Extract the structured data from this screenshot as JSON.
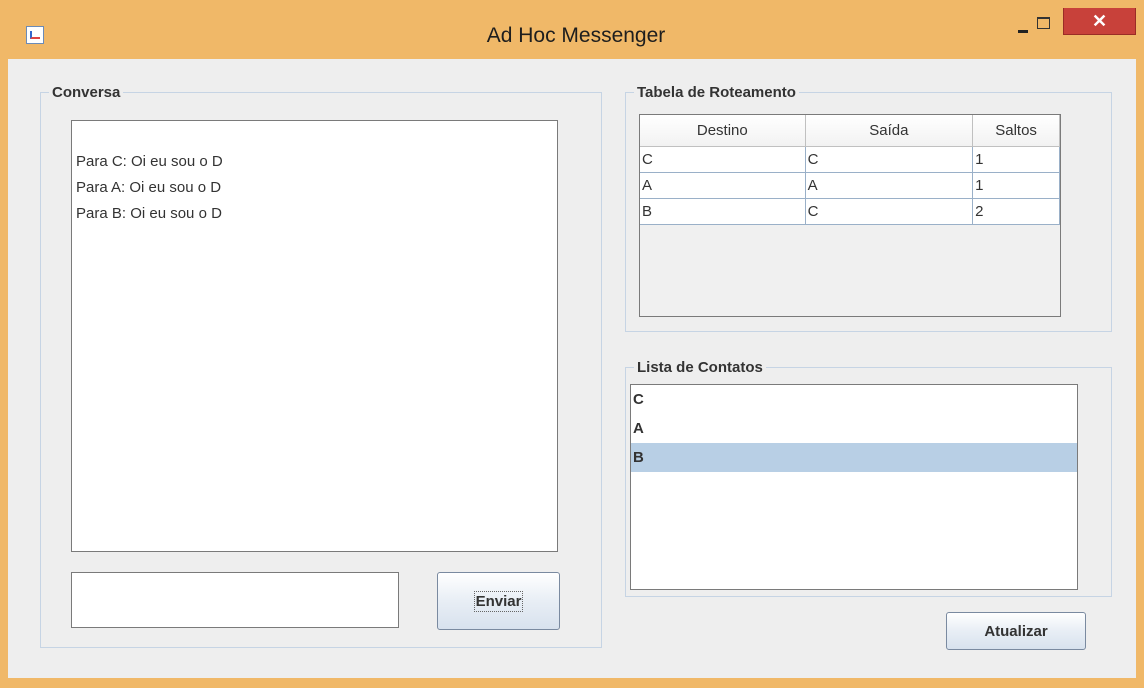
{
  "window": {
    "title": "Ad Hoc Messenger",
    "close_symbol": "✕"
  },
  "conversa": {
    "title": "Conversa",
    "messages": [
      "Para C: Oi eu sou o D",
      "Para A: Oi eu sou o D",
      "Para B: Oi eu sou o D"
    ],
    "input_value": "",
    "send_label": "Enviar"
  },
  "routing": {
    "title": "Tabela de Roteamento",
    "columns": [
      "Destino",
      "Saída",
      "Saltos"
    ],
    "rows": [
      [
        "C",
        "C",
        "1"
      ],
      [
        "A",
        "A",
        "1"
      ],
      [
        "B",
        "C",
        "2"
      ]
    ]
  },
  "contacts": {
    "title": "Lista de Contatos",
    "items": [
      "C",
      "A",
      "B"
    ],
    "selected": "B"
  },
  "update_label": "Atualizar",
  "colors": {
    "selection": "#b8cfe5",
    "close_button": "#c8413a",
    "title_bar": "#f0b868"
  }
}
